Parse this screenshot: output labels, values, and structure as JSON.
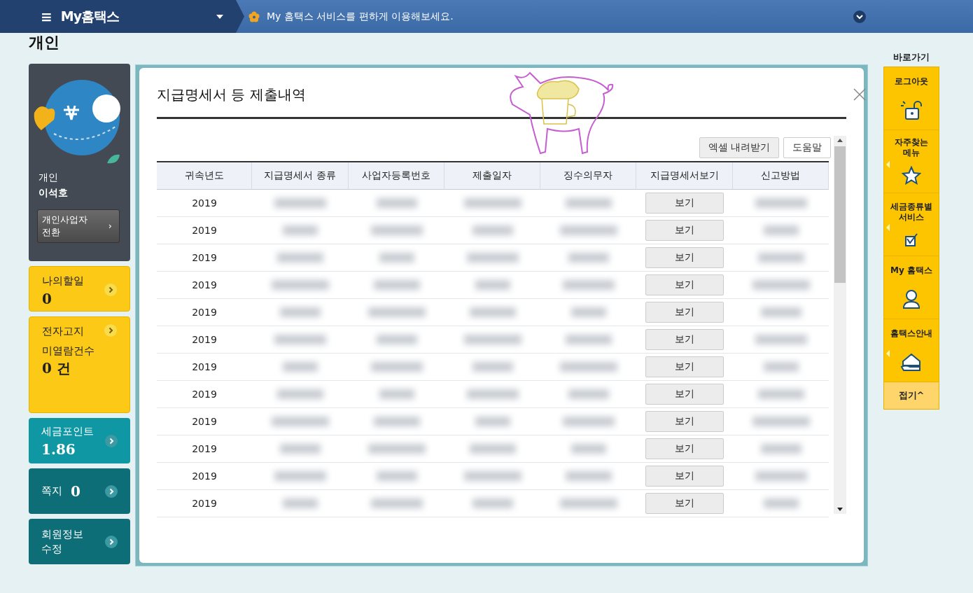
{
  "top_bar": {
    "menu_icon": "≡",
    "title": "My홈택스",
    "notice": "My 홈택스 서비스를 편하게 이용해보세요."
  },
  "page_title": "개인",
  "profile": {
    "type": "개인",
    "name": "이석호",
    "switch_button": "개인사업자\n전환",
    "switch_arrow": "›"
  },
  "left_cards": [
    {
      "kind": "yellow",
      "label": "나의할일",
      "value": "0"
    },
    {
      "kind": "yellow-tall",
      "label": "전자고지",
      "sub": "미열람건수",
      "value": "0 건"
    },
    {
      "kind": "teal",
      "label": "세금포인트",
      "value": "1.86"
    },
    {
      "kind": "dark-teal",
      "label": "쪽지",
      "value": "0"
    },
    {
      "kind": "dark-teal",
      "label": "회원정보\n수정"
    }
  ],
  "modal": {
    "title": "지급명세서 등 제출내역",
    "buttons": [
      "엑셀 내려받기",
      "도움말"
    ],
    "table": {
      "columns": [
        "귀속년도",
        "지급명세서 종류",
        "사업자등록번호",
        "제출일자",
        "징수의무자",
        "지급명세서보기",
        "신고방법"
      ],
      "rows": [
        {
          "year": "2019",
          "view": "보기"
        },
        {
          "year": "2019",
          "view": "보기"
        },
        {
          "year": "2019",
          "view": "보기"
        },
        {
          "year": "2019",
          "view": "보기"
        },
        {
          "year": "2019",
          "view": "보기"
        },
        {
          "year": "2019",
          "view": "보기"
        },
        {
          "year": "2019",
          "view": "보기"
        },
        {
          "year": "2019",
          "view": "보기"
        },
        {
          "year": "2019",
          "view": "보기"
        },
        {
          "year": "2019",
          "view": "보기"
        },
        {
          "year": "2019",
          "view": "보기"
        },
        {
          "year": "2019",
          "view": "보기"
        }
      ]
    }
  },
  "quick_menu": {
    "title": "바로가기",
    "items": [
      {
        "kind": "lock",
        "label": "로그아웃",
        "has_pointer": false
      },
      {
        "kind": "star",
        "label": "자주찾는\n메뉴",
        "has_pointer": true
      },
      {
        "kind": "check",
        "label": "세금종류별\n서비스",
        "has_pointer": true
      },
      {
        "kind": "person",
        "label": "My 홈택스",
        "has_pointer": false
      },
      {
        "kind": "house",
        "label": "홈택스안내",
        "has_pointer": true
      }
    ],
    "collapse": "접기^"
  }
}
